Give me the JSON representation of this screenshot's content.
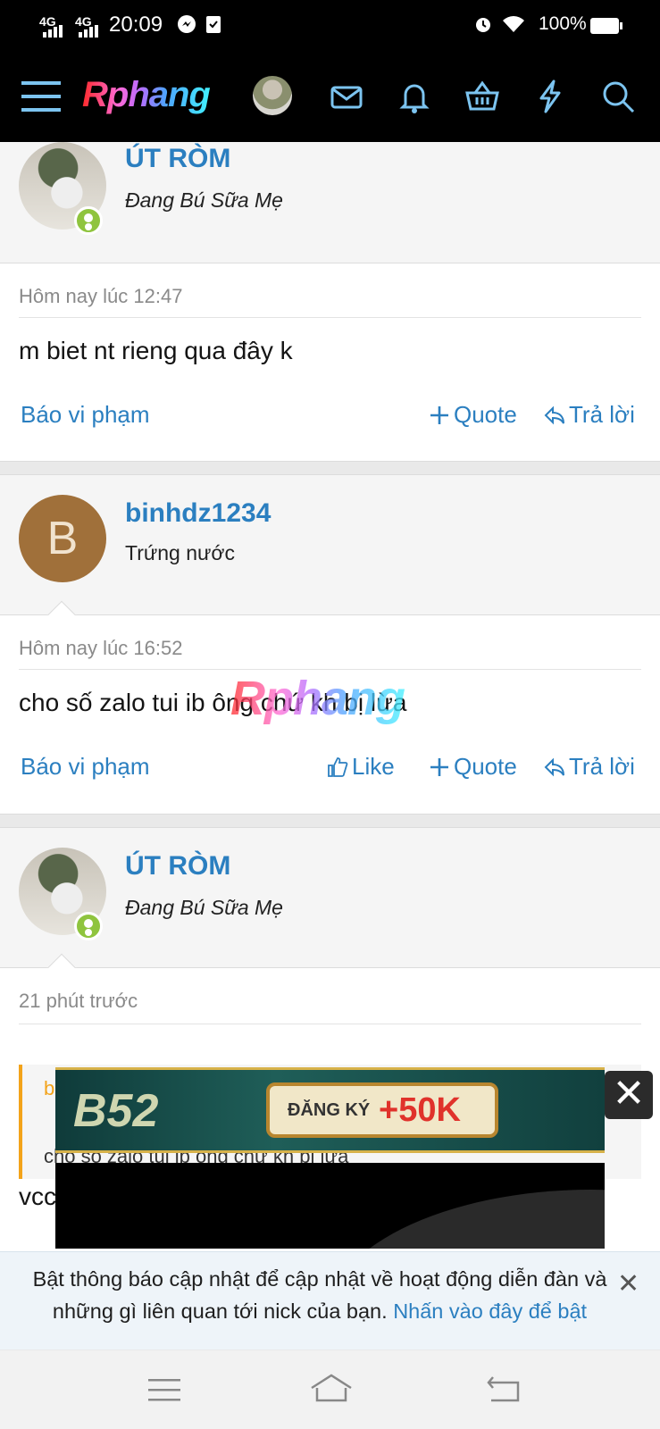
{
  "status_bar": {
    "signal1": "4G",
    "signal2": "4G",
    "time": "20:09",
    "battery": "100%"
  },
  "nav": {
    "logo": "Rphang"
  },
  "posts": [
    {
      "username": "ÚT RÒM",
      "user_title": "Đang Bú Sữa Mẹ",
      "time": "Hôm nay lúc 12:47",
      "text": "m biet nt rieng qua đây k",
      "report": "Báo vi phạm",
      "quote": "Quote",
      "reply": "Trả lời"
    },
    {
      "username": "binhdz1234",
      "avatar_letter": "B",
      "user_title": "Trứng nước",
      "time": "Hôm nay lúc 16:52",
      "text": "cho số zalo tui ib ông chứ kh bị lừa",
      "report": "Báo vi phạm",
      "like": "Like",
      "quote": "Quote",
      "reply": "Trả lời"
    },
    {
      "username": "ÚT RÒM",
      "user_title": "Đang Bú Sữa Mẹ",
      "time": "21 phút trước",
      "quoted_user": "b",
      "quoted_text": "cho số zalo tui ib ông chứ kh bị lừa",
      "text_partial": "vcc"
    }
  ],
  "watermark": "Rphang",
  "ad": {
    "brand": "B52",
    "cta_text": "ĐĂNG KÝ",
    "cta_value": "+50K"
  },
  "notice": {
    "text": "Bật thông báo cập nhật để cập nhật về hoạt động diễn đàn và những gì liên quan tới nick của bạn.",
    "link": "Nhấn vào đây để bật"
  },
  "colors": {
    "link": "#2b7fc0",
    "online": "#8fc43e",
    "quote_border": "#f3a31a"
  }
}
